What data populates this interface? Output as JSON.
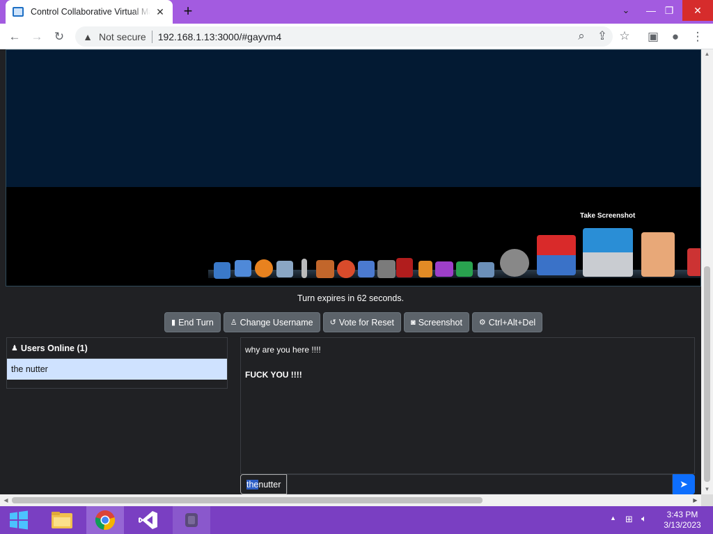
{
  "browser": {
    "tab_title": "Control Collaborative Virtual Machine",
    "new_tab_symbol": "+",
    "security_label": "Not secure",
    "url": "192.168.1.13:3000/#gayvm4"
  },
  "vm": {
    "tooltip": "Take Screenshot"
  },
  "turn": {
    "text": "Turn expires in 62 seconds."
  },
  "controls": {
    "end_turn": "End Turn",
    "change_username": "Change Username",
    "vote_reset": "Vote for Reset",
    "screenshot": "Screenshot",
    "ctrl_alt_del": "Ctrl+Alt+Del"
  },
  "users": {
    "header": "Users Online (1)",
    "list": [
      "the nutter"
    ]
  },
  "chat": {
    "messages": [
      {
        "text": "why are you here !!!!",
        "bold": false
      },
      {
        "text": "FUCK YOU !!!!",
        "bold": true
      }
    ],
    "username_highlight": "the",
    "username_rest": " nutter",
    "input_value": ""
  },
  "taskbar": {
    "time": "3:43 PM",
    "date": "3/13/2023"
  },
  "colors": {
    "titlebar": "#a35be0",
    "taskbar": "#7a3fc2",
    "page_bg": "#202124",
    "button_bg": "#5c636a",
    "send_button": "#0d6efd",
    "user_highlight": "#cfe2ff"
  }
}
